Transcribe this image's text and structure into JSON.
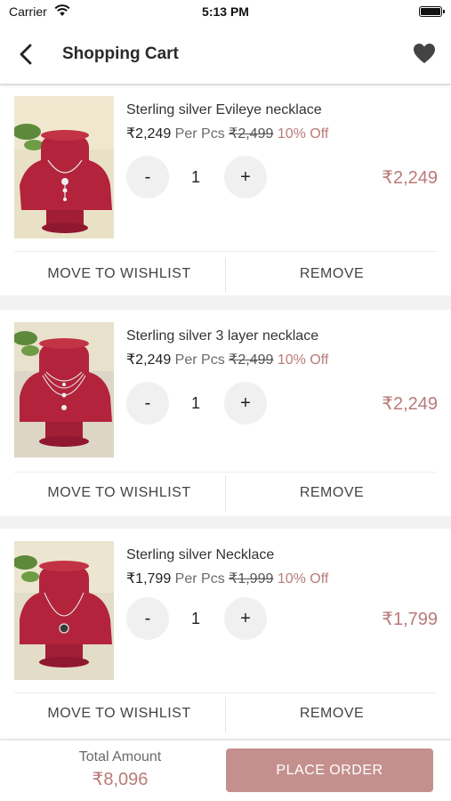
{
  "status_bar": {
    "carrier": "Carrier",
    "time": "5:13 PM"
  },
  "header": {
    "title": "Shopping Cart",
    "back_icon": "chevron-left-icon",
    "wishlist_icon": "heart-icon"
  },
  "colors": {
    "accent": "#b97a78",
    "button": "#c4908e"
  },
  "cart": {
    "items": [
      {
        "name": "Sterling silver Evileye necklace",
        "price": "₹2,249",
        "unit": "Per Pcs",
        "mrp": "₹2,499",
        "discount": "10% Off",
        "quantity": "1",
        "line_total": "₹2,249",
        "move_label": "MOVE TO WISHLIST",
        "remove_label": "REMOVE",
        "decrement": "-",
        "increment": "+"
      },
      {
        "name": "Sterling silver 3 layer necklace",
        "price": "₹2,249",
        "unit": "Per Pcs",
        "mrp": "₹2,499",
        "discount": "10% Off",
        "quantity": "1",
        "line_total": "₹2,249",
        "move_label": "MOVE TO WISHLIST",
        "remove_label": "REMOVE",
        "decrement": "-",
        "increment": "+"
      },
      {
        "name": "Sterling silver Necklace",
        "price": "₹1,799",
        "unit": "Per Pcs",
        "mrp": "₹1,999",
        "discount": "10% Off",
        "quantity": "1",
        "line_total": "₹1,799",
        "move_label": "MOVE TO WISHLIST",
        "remove_label": "REMOVE",
        "decrement": "-",
        "increment": "+"
      }
    ]
  },
  "footer": {
    "total_label": "Total Amount",
    "total_value": "₹8,096",
    "place_order_label": "PLACE ORDER"
  }
}
